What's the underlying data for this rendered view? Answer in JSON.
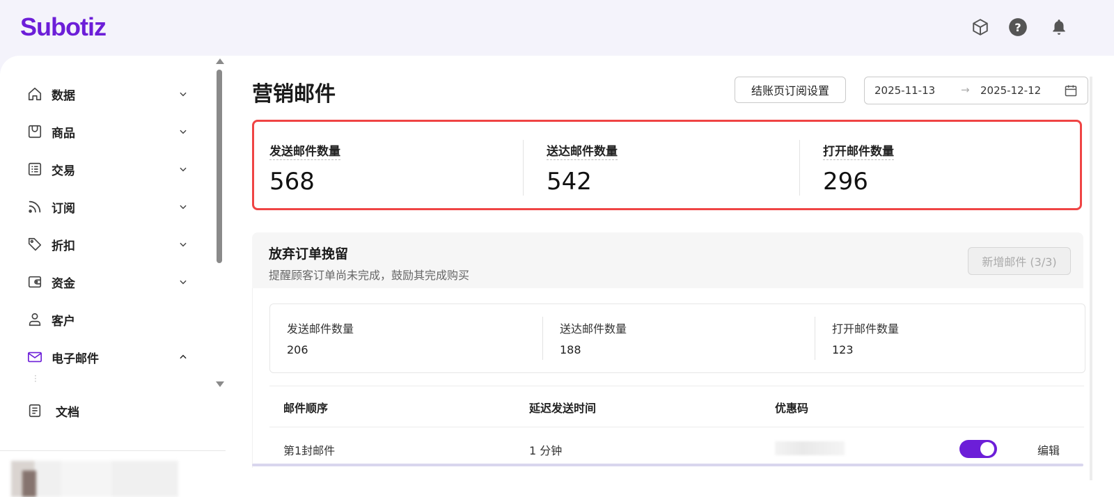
{
  "app": {
    "logo_text": "Subotiz",
    "brand_color": "#6c1ed8",
    "highlight_color": "#ef4444"
  },
  "header": {
    "icons": [
      "package-icon",
      "help-icon",
      "bell-icon"
    ]
  },
  "sidebar": {
    "items": [
      {
        "label": "数据",
        "icon": "home-icon",
        "expanded": false
      },
      {
        "label": "商品",
        "icon": "store-icon",
        "expanded": false
      },
      {
        "label": "交易",
        "icon": "list-icon",
        "expanded": false
      },
      {
        "label": "订阅",
        "icon": "rss-icon",
        "expanded": false
      },
      {
        "label": "折扣",
        "icon": "tag-icon",
        "expanded": false
      },
      {
        "label": "资金",
        "icon": "wallet-icon",
        "expanded": false
      },
      {
        "label": "客户",
        "icon": "user-icon"
      },
      {
        "label": "电子邮件",
        "icon": "mail-icon",
        "expanded": true
      },
      {
        "label": "文档",
        "icon": "document-icon"
      }
    ]
  },
  "main": {
    "title": "营销邮件",
    "checkout_button": "结账页订阅设置",
    "date_range": {
      "start": "2025-11-13",
      "separator": "→",
      "end": "2025-12-12"
    },
    "summary": [
      {
        "label": "发送邮件数量",
        "value": "568"
      },
      {
        "label": "送达邮件数量",
        "value": "542"
      },
      {
        "label": "打开邮件数量",
        "value": "296"
      }
    ],
    "section": {
      "title": "放弃订单挽留",
      "subtitle": "提醒顾客订单尚未完成，鼓励其完成购买",
      "add_button": "新增邮件 (3/3)",
      "stats": [
        {
          "label": "发送邮件数量",
          "value": "206"
        },
        {
          "label": "送达邮件数量",
          "value": "188"
        },
        {
          "label": "打开邮件数量",
          "value": "123"
        }
      ],
      "table": {
        "columns": [
          "邮件顺序",
          "延迟发送时间",
          "优惠码"
        ],
        "rows": [
          {
            "order": "第1封邮件",
            "delay": "1 分钟",
            "enabled": true,
            "edit_label": "编辑"
          }
        ]
      }
    }
  }
}
